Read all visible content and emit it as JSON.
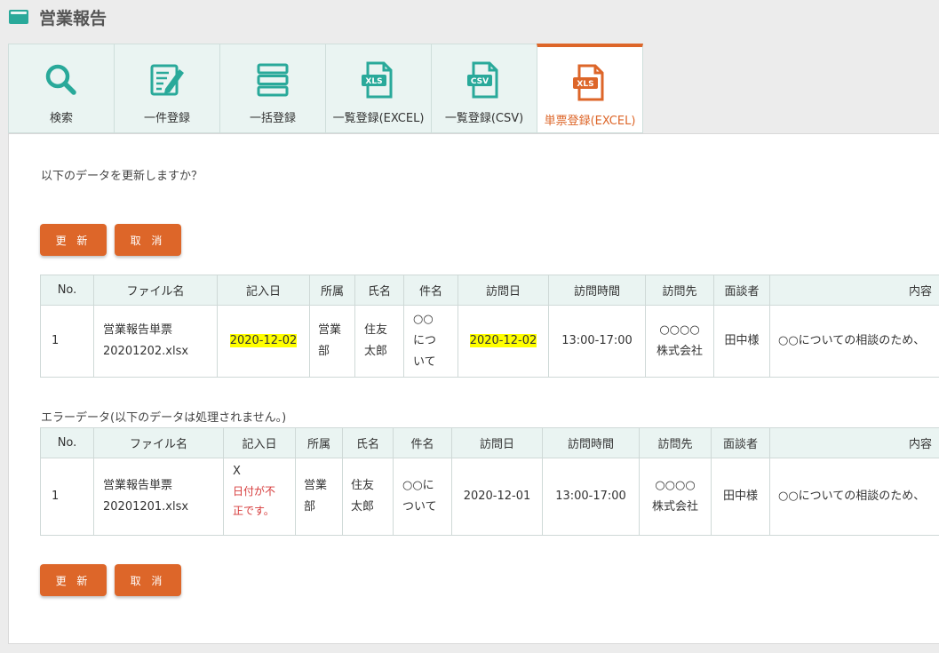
{
  "header": {
    "title": "営業報告"
  },
  "tabs": [
    {
      "label": "検索",
      "icon": "search-icon",
      "active": false
    },
    {
      "label": "一件登録",
      "icon": "edit-form-icon",
      "active": false
    },
    {
      "label": "一括登録",
      "icon": "stack-list-icon",
      "active": false
    },
    {
      "label": "一覧登録(EXCEL)",
      "icon": "xls-file-icon",
      "badge": "XLS",
      "active": false
    },
    {
      "label": "一覧登録(CSV)",
      "icon": "csv-file-icon",
      "badge": "CSV",
      "active": false
    },
    {
      "label": "単票登録(EXCEL)",
      "icon": "xls-file-icon",
      "badge": "XLS",
      "active": true
    }
  ],
  "main": {
    "confirm_text": "以下のデータを更新しますか？",
    "update_label": "更 新",
    "cancel_label": "取 消",
    "error_caption": "エラーデータ(以下のデータは処理されません。)"
  },
  "table_headers": [
    "No.",
    "ファイル名",
    "記入日",
    "所属",
    "氏名",
    "件名",
    "訪問日",
    "訪問時間",
    "訪問先",
    "面談者",
    "内容"
  ],
  "valid_rows": [
    {
      "no": "1",
      "file_line1": "営業報告単票",
      "file_line2": "20201202.xlsx",
      "entry_date": "2020-12-02",
      "dept_line1": "営業",
      "dept_line2": "部",
      "name_line1": "住友",
      "name_line2": "太郎",
      "subject_line1": "○○",
      "subject_line2": "につ",
      "subject_line3": "いて",
      "visit_date": "2020-12-02",
      "visit_time": "13:00-17:00",
      "dest_line1": "○○○○",
      "dest_line2": "株式会社",
      "interviewer": "田中様",
      "content": "○○についての相談のため、"
    }
  ],
  "error_rows": [
    {
      "no": "1",
      "file_line1": "営業報告単票",
      "file_line2": "20201201.xlsx",
      "entry_date": "X",
      "entry_error_line1": "日付が不",
      "entry_error_line2": "正です。",
      "dept_line1": "営業",
      "dept_line2": "部",
      "name_line1": "住友",
      "name_line2": "太郎",
      "subject_line1": "○○に",
      "subject_line2": "ついて",
      "visit_date": "2020-12-01",
      "visit_time": "13:00-17:00",
      "dest_line1": "○○○○",
      "dest_line2": "株式会社",
      "interviewer": "田中様",
      "content": "○○についての相談のため、"
    }
  ],
  "colors": {
    "accent": "#dd6629",
    "teal": "#29a99a",
    "highlight": "#ffff00",
    "error_text": "#d63a3a",
    "tab_bg": "#eaf4f2"
  }
}
